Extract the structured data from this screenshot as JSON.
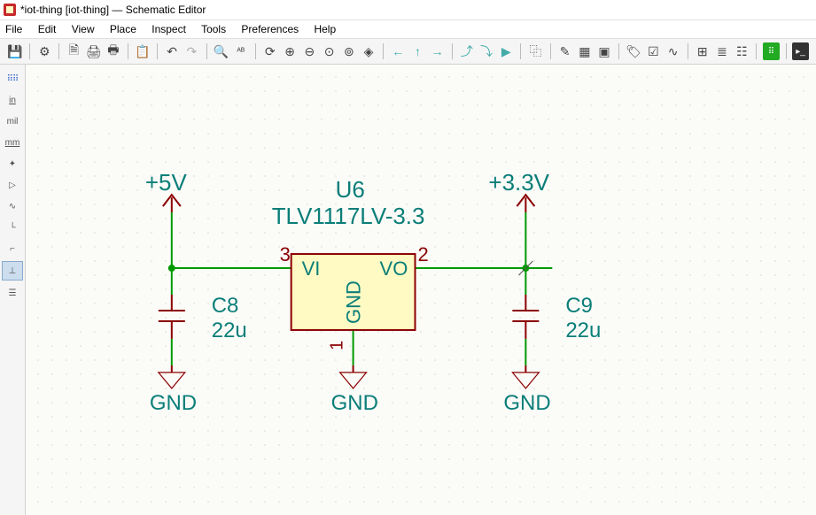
{
  "window": {
    "title": "*iot-thing [iot-thing] — Schematic Editor"
  },
  "menu": {
    "file": "File",
    "edit": "Edit",
    "view": "View",
    "place": "Place",
    "inspect": "Inspect",
    "tools": "Tools",
    "preferences": "Preferences",
    "help": "Help"
  },
  "sidebar": {
    "in": "in",
    "mil": "mil",
    "mm": "mm"
  },
  "schematic": {
    "power_in": {
      "label": "+5V",
      "gnd": "GND"
    },
    "power_out": {
      "label": "+3.3V",
      "gnd": "GND"
    },
    "u6": {
      "ref": "U6",
      "value": "TLV1117LV-3.3",
      "pin_vi": {
        "num": "3",
        "name": "VI"
      },
      "pin_vo": {
        "num": "2",
        "name": "VO"
      },
      "pin_gnd": {
        "num": "1",
        "name": "GND"
      },
      "gnd": "GND"
    },
    "c8": {
      "ref": "C8",
      "value": "22u"
    },
    "c9": {
      "ref": "C9",
      "value": "22u"
    }
  }
}
